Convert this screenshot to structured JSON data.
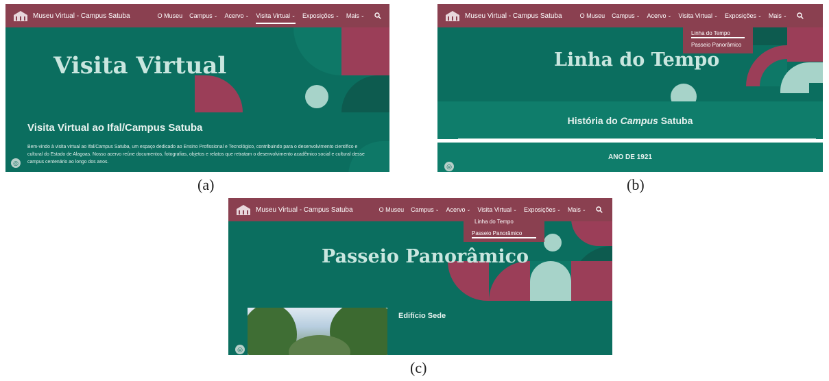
{
  "nav": {
    "brand": "Museu Virtual - Campus Satuba",
    "items": [
      "O Museu",
      "Campus",
      "Acervo",
      "Visita Virtual",
      "Exposições",
      "Mais"
    ],
    "chevron": "⌄",
    "search_icon": "search-icon",
    "logo_icon": "museum-logo-icon"
  },
  "panel_a": {
    "hero_title": "Visita Virtual",
    "section_title": "Visita Virtual ao Ifal/Campus Satuba",
    "body_text": "Bem-vindo à visita virtual ao Ifal/Campus Satuba, um espaço dedicado ao Ensino Profissional e Tecnológico, contribuindo para o desenvolvimento científico e cultural do Estado de Alagoas. Nosso acervo reúne documentos, fotografias, objetos e relatos que retratam o desenvolvimento acadêmico social e cultural desse campus centenário ao longo dos anos."
  },
  "panel_b": {
    "hero_title": "Linha do Tempo",
    "history_prefix": "História do ",
    "history_italic": "Campus",
    "history_suffix": " Satuba",
    "year_label": "ANO DE 1921",
    "dropdown": [
      "Linha do Tempo",
      "Passeio Panorâmico"
    ]
  },
  "panel_c": {
    "hero_title": "Passeio Panorâmico",
    "building_title": "Edifício Sede",
    "dropdown": [
      "Linha do Tempo",
      "Passeio Panorâmico"
    ]
  },
  "captions": {
    "a": "(a)",
    "b": "(b)",
    "c": "(c)"
  },
  "colors": {
    "teal": "#0b6e5f",
    "rose": "#8a4050",
    "mint": "#a7d3c9"
  }
}
